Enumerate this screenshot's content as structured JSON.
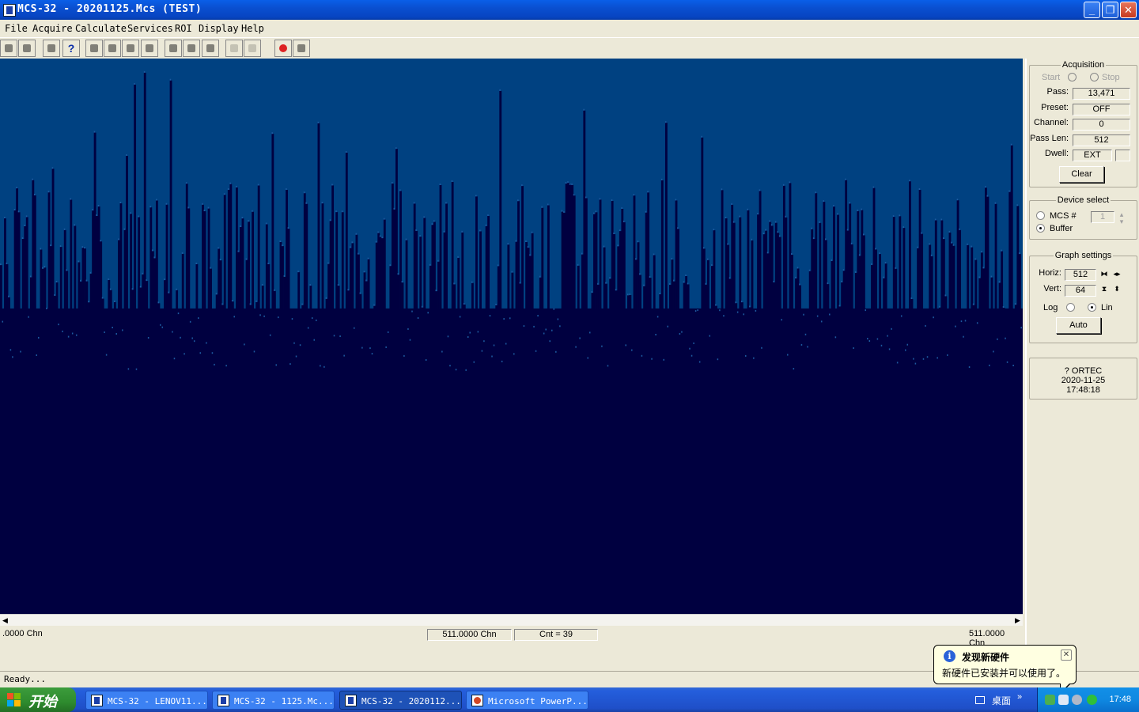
{
  "window": {
    "title": "MCS-32 - 20201125.Mcs (TEST)",
    "minimize": "_",
    "restore": "❐",
    "close": "✕"
  },
  "menu": [
    "File",
    "Acquire",
    "Calculate",
    "Services",
    "ROI",
    "Display",
    "Help"
  ],
  "toolbar": {
    "icons": [
      "open-icon",
      "save-icon",
      "copy-icon",
      "help-icon",
      "marker-left-icon",
      "marker-right-icon",
      "peak-left-icon",
      "peak-right-icon",
      "zoom-icon",
      "roi-prev-icon",
      "roi-next-icon",
      "roi-add-icon",
      "roi-remove-icon",
      "stop-icon",
      "fullview-icon"
    ],
    "help_label": "?"
  },
  "spectrum": {
    "channels": 512,
    "vertical_full_scale": 64,
    "bg_color": "#000040",
    "fill_color": "#003E7E",
    "level_color": "#004181"
  },
  "readouts": {
    "left": ".0000 Chn",
    "cursor": "511.0000 Chn",
    "count": "Cnt = 39",
    "right": "511.0000 Chn"
  },
  "scroll": {
    "left_arrow": "◀",
    "right_arrow": "▶"
  },
  "acquisition": {
    "title": "Acquisition",
    "start_label": "Start",
    "stop_label": "Stop",
    "pass_label": "Pass:",
    "pass_value": "13,471",
    "preset_label": "Preset:",
    "preset_value": "OFF",
    "channel_label": "Channel:",
    "channel_value": "0",
    "passlen_label": "Pass Len:",
    "passlen_value": "512",
    "dwell_label": "Dwell:",
    "dwell_value": "EXT",
    "dwell_unit": "",
    "clear_button": "Clear"
  },
  "device_select": {
    "title": "Device select",
    "mcs_label": "MCS #",
    "mcs_value": "1",
    "buffer_label": "Buffer",
    "selected": "Buffer"
  },
  "graph_settings": {
    "title": "Graph settings",
    "horiz_label": "Horiz:",
    "horiz_value": "512",
    "vert_label": "Vert:",
    "vert_value": "64",
    "log_label": "Log",
    "lin_label": "Lin",
    "scale": "Lin",
    "auto_button": "Auto"
  },
  "info_box": {
    "line1": "? ORTEC",
    "line2": "2020-11-25",
    "line3": "17:48:18"
  },
  "status_bar": {
    "text": "Ready..."
  },
  "taskbar": {
    "start_label": "开始",
    "tasks": [
      {
        "label": "MCS-32 - LENOV11...",
        "active": false
      },
      {
        "label": "MCS-32 - 1125.Mc...",
        "active": false
      },
      {
        "label": "MCS-32 - 2020112...",
        "active": true
      },
      {
        "label": "Microsoft PowerP...",
        "active": false
      }
    ],
    "desktop_label": "桌面",
    "chevron": "»",
    "clock": "17:48"
  },
  "balloon": {
    "title": "发现新硬件",
    "body": "新硬件已安装并可以使用了。",
    "close": "✕",
    "info": "i"
  }
}
